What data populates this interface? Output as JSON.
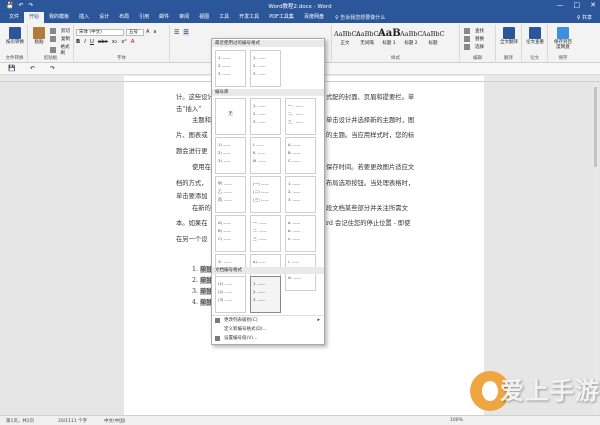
{
  "window": {
    "title": "Word教程2.docx - Word",
    "controls": [
      "—",
      "□",
      "✕"
    ]
  },
  "quick_access": [
    "💾",
    "↶",
    "↷"
  ],
  "tabs": [
    "文件",
    "开始",
    "我的模板",
    "插入",
    "设计",
    "布局",
    "引用",
    "邮件",
    "审阅",
    "视图",
    "工具",
    "开发工具",
    "PDF工具集",
    "百度网盘"
  ],
  "tab_active_index": 1,
  "search_text": "♀ 告诉我您想要做什么",
  "share_text": "♀ 共享",
  "ribbon": {
    "groups": {
      "file": "文件转换",
      "clipboard": "剪贴板",
      "font": "字体",
      "styles": "样式",
      "editing": "编辑",
      "translate": "翻译",
      "paper": "论文",
      "save": "保存"
    },
    "big_buttons": {
      "convert": "按页转换",
      "paste": "粘贴",
      "translate": "全文翻译",
      "paper_check": "论文查重",
      "save_baidu": "保存到百度网盘"
    },
    "clipboard_small": [
      "剪切",
      "复制",
      "格式刷"
    ],
    "font_name": "宋体 (中文)",
    "font_size": "五号",
    "styles": [
      {
        "sample": "AaBbCc",
        "name": "正文"
      },
      {
        "sample": "AaBbCc",
        "name": "无间隔"
      },
      {
        "sample": "AaB",
        "name": "标题 1"
      },
      {
        "sample": "AaBbC",
        "name": "标题 2"
      },
      {
        "sample": "AaBbC",
        "name": "标题"
      },
      {
        "sample": "AaBbCc",
        "name": "副标题"
      },
      {
        "sample": "AaBbCcD",
        "name": "不明显强调"
      },
      {
        "sample": "AaBbCcD",
        "name": "强调"
      }
    ],
    "editing": [
      "查找",
      "替换",
      "选择"
    ]
  },
  "document": {
    "lines": [
      "计。这些设计",
      "主题和",
      "片、图表或",
      "题会进行更",
      "使用在",
      "档的方式，",
      "单击要添加",
      "在新的",
      "本。如果在",
      "在另一个设",
      "式配的封面、页眉和提要栏。单",
      "击“插入”",
      "单击设计并选择新的主题时，图",
      "的主题。当应用样式时，您的标",
      "保存时间。若要更改图片适应文",
      "布局选项按钮。当处理表格时，",
      "段文档某些部分并关注所需文",
      "rd 会记住您的停止位置 - 即使"
    ],
    "list": [
      {
        "num": "1.",
        "text": "单独"
      },
      {
        "num": "2.",
        "text": "单独"
      },
      {
        "num": "3.",
        "text": "单独"
      },
      {
        "num": "4.",
        "text": "单独"
      }
    ]
  },
  "dropdown": {
    "recent_header": "最近使用过的编号格式",
    "library_header": "编号库",
    "doc_header": "文档编号格式",
    "none_label": "无",
    "recent_cells": [
      [
        "1. ——",
        "2. ——",
        "3. ——"
      ],
      [
        "1. ——",
        "2. ——",
        "3. ——"
      ]
    ],
    "library_cells": [
      [
        "1. ——",
        "2. ——",
        "3. ——"
      ],
      [
        "一、——",
        "二、——",
        "三、——"
      ],
      [
        "1) ——",
        "2) ——",
        "3) ——"
      ],
      [
        "I. ——",
        "II. ——",
        "III. ——"
      ],
      [
        "A. ——",
        "B. ——",
        "C. ——"
      ],
      [
        "a) ——",
        "b) ——",
        "c) ——"
      ],
      [
        "a. ——",
        "b. ——",
        "c. ——"
      ],
      [
        "i. ——",
        "ii. ——",
        "iii. ——"
      ],
      [
        "(一) ——",
        "(二) ——",
        "(三) ——"
      ],
      [
        "①. ——",
        "②. ——",
        "③. ——"
      ],
      [
        "一. ——",
        "二. ——",
        "三. ——"
      ],
      [
        "1. ——",
        "2. ——",
        "3. ——"
      ],
      [
        "甲. ——",
        "乙. ——",
        "丙. ——"
      ],
      [
        "A) ——",
        "B) ——",
        "C) ——"
      ],
      [
        "(1) ——",
        "(2) ——",
        "(3) ——"
      ]
    ],
    "doc_cells": [
      [
        "(1) ——",
        "(2) ——",
        "(3) ——"
      ],
      [
        "1. ——",
        "2. ——",
        "3. ——"
      ]
    ],
    "menu": [
      {
        "label": "更改列表级别(C)",
        "arrow": "▸"
      },
      {
        "label": "定义新编号格式(D)...",
        "arrow": ""
      },
      {
        "label": "设置编号值(V)...",
        "arrow": ""
      }
    ]
  },
  "status": {
    "page": "第1页，共2页",
    "words": "20/1111 个字",
    "lang": "中文(中国)",
    "zoom": "100%"
  },
  "watermark": "爱上手游网"
}
